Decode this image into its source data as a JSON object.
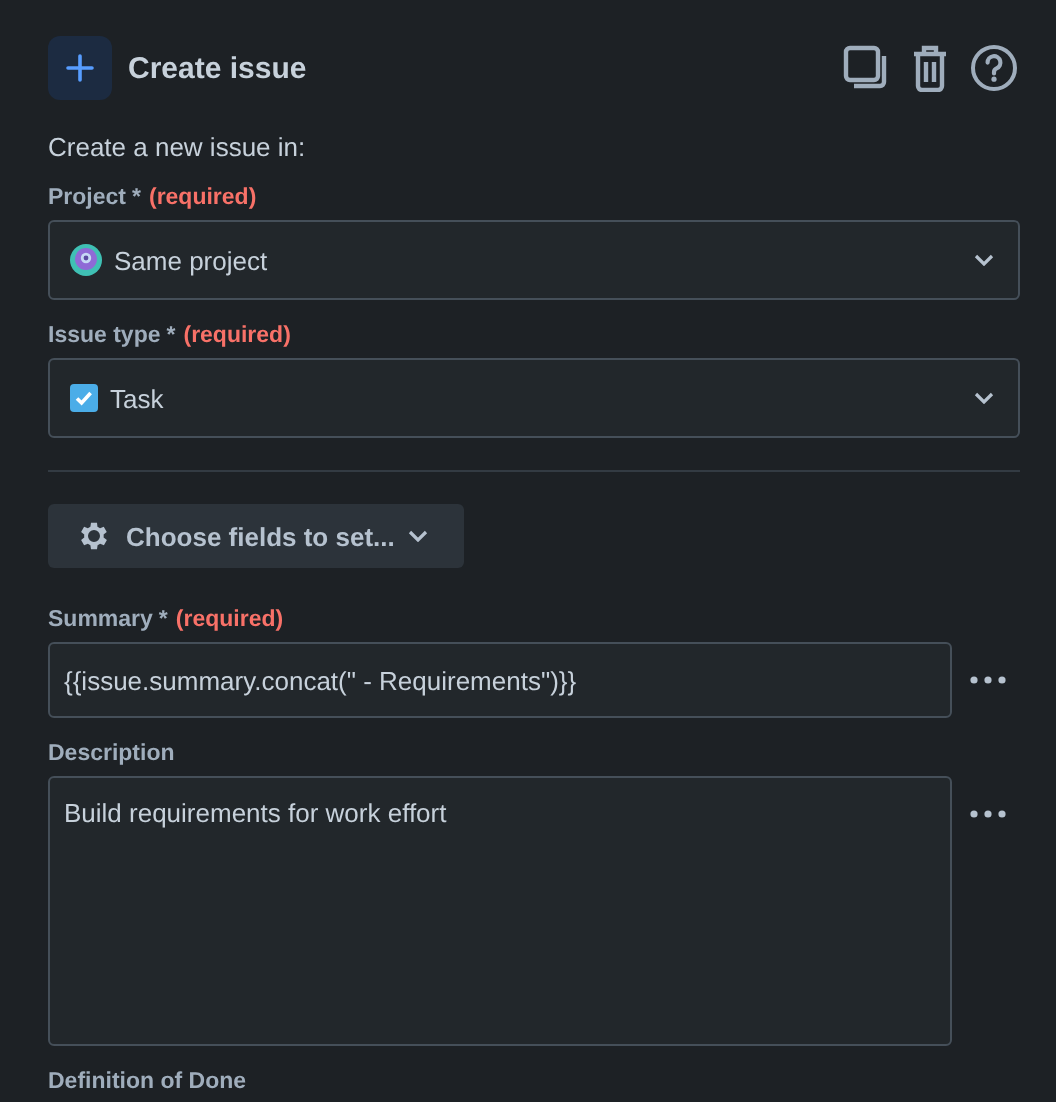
{
  "header": {
    "title": "Create issue"
  },
  "intro": "Create a new issue in:",
  "selects": [
    {
      "label": "Project",
      "required_mark": "*",
      "required_text": "(required)",
      "value": "Same project",
      "kind": "project"
    },
    {
      "label": "Issue type",
      "required_mark": "*",
      "required_text": "(required)",
      "value": "Task",
      "kind": "task"
    }
  ],
  "choose_button": {
    "label": "Choose fields to set..."
  },
  "fields": [
    {
      "label": "Summary",
      "required_mark": "*",
      "required_text": "(required)",
      "value": "{{issue.summary.concat(\" - Requirements\")}}",
      "kind": "line"
    },
    {
      "label": "Description",
      "value": "Build requirements for work effort",
      "kind": "area"
    },
    {
      "label": "Definition of Done",
      "kind": "label_only"
    }
  ]
}
